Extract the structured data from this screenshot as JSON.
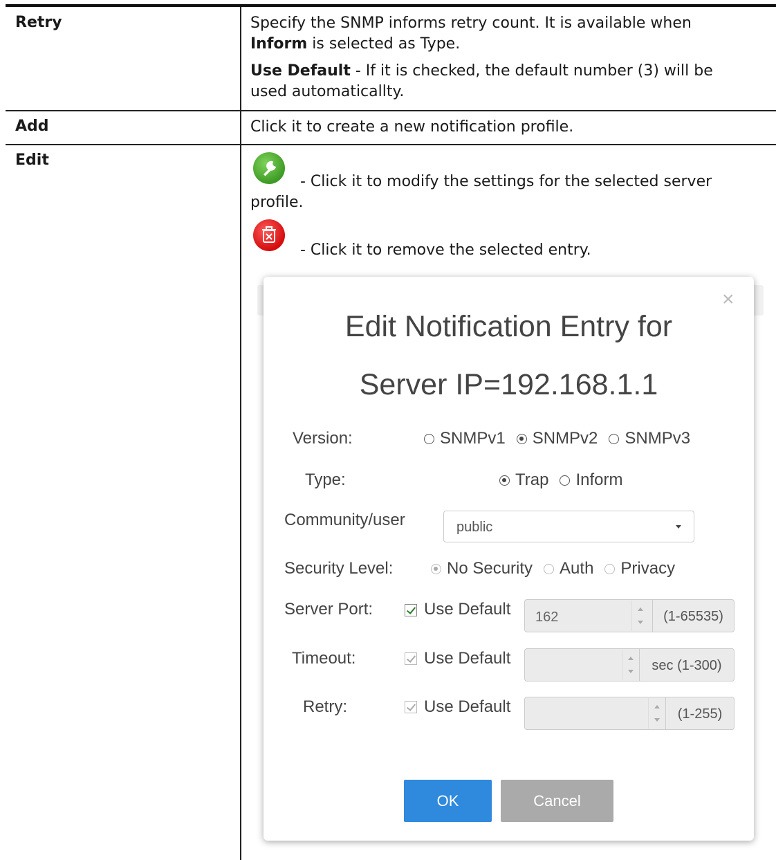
{
  "rows": {
    "retry": {
      "term": "Retry",
      "line1": "Specify the SNMP informs retry count. It is available when",
      "line2_bold": "Inform",
      "line2_rest": " is selected as Type.",
      "line3_bold": "Use Default",
      "line3_rest": " - If it is checked, the default number (3) will be",
      "line4": "used automaticallty."
    },
    "add": {
      "term": "Add",
      "desc": "Click it to create a new notification profile."
    },
    "edit": {
      "term": "Edit",
      "wrench_line1": "- Click it to modify the settings for the selected server",
      "wrench_line2": "profile.",
      "trash_line": "- Click it to remove the selected entry."
    }
  },
  "icons": {
    "edit": "wrench-icon",
    "delete": "trash-icon",
    "close": "close-icon"
  },
  "colors": {
    "edit_icon": "#4caf30",
    "delete_icon": "#e01010",
    "ok_button": "#2f89dc",
    "cancel_button": "#aaaaaa"
  },
  "dialog": {
    "close": "×",
    "title_line1": "Edit Notification Entry for",
    "title_line2": "Server IP=192.168.1.1",
    "version": {
      "label": "Version:",
      "options": [
        "SNMPv1",
        "SNMPv2",
        "SNMPv3"
      ],
      "selected": "SNMPv2"
    },
    "type": {
      "label": "Type:",
      "options": [
        "Trap",
        "Inform"
      ],
      "selected": "Trap"
    },
    "community": {
      "label": "Community/user",
      "value": "public"
    },
    "security": {
      "label": "Security Level:",
      "options": [
        "No Security",
        "Auth",
        "Privacy"
      ],
      "selected": "No Security"
    },
    "server_port": {
      "label": "Server Port:",
      "use_default": "Use Default",
      "value": "162",
      "range": "(1-65535)"
    },
    "timeout": {
      "label": "Timeout:",
      "use_default": "Use Default",
      "value": "",
      "range": "sec (1-300)"
    },
    "retry": {
      "label": "Retry:",
      "use_default": "Use Default",
      "value": "",
      "range": "(1-255)"
    },
    "ok": "OK",
    "cancel": "Cancel"
  }
}
